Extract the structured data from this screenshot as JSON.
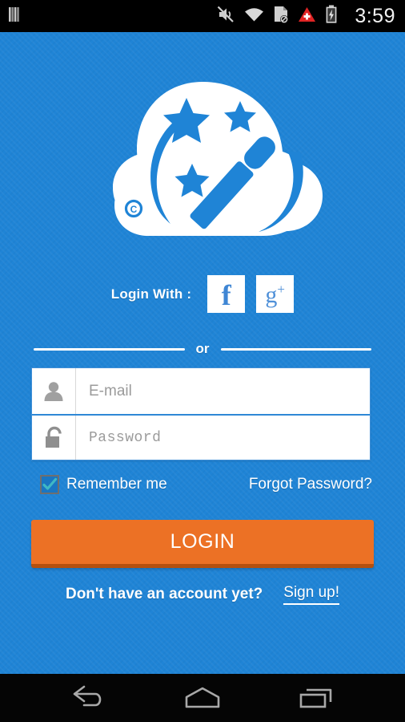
{
  "statusbar": {
    "time": "3:59",
    "icons": [
      "sim-signal-icon",
      "mute-icon",
      "wifi-icon",
      "sd-card-disabled-icon",
      "alert-triangle-icon",
      "battery-charging-icon"
    ]
  },
  "logo": {
    "name": "cloud-magic-wand-logo",
    "copyright_mark": "C",
    "color": "#ffffff"
  },
  "social": {
    "label": "Login With :",
    "buttons": [
      {
        "name": "facebook-login-button",
        "glyph": "f"
      },
      {
        "name": "google-plus-login-button",
        "glyph": "g",
        "sup": "+"
      }
    ]
  },
  "divider": {
    "text": "or"
  },
  "form": {
    "email": {
      "placeholder": "E-mail",
      "value": "",
      "icon": "user-icon"
    },
    "password": {
      "placeholder": "Password",
      "value": "",
      "icon": "unlocked-padlock-icon"
    }
  },
  "options": {
    "remember_label": "Remember me",
    "remember_checked": true,
    "forgot_label": "Forgot Password?"
  },
  "actions": {
    "login_label": "LOGIN"
  },
  "signup": {
    "prompt": "Don't have an account yet?",
    "link_label": "Sign up!"
  },
  "navbar": {
    "back": "back-icon",
    "home": "home-icon",
    "recents": "recent-apps-icon"
  },
  "colors": {
    "background_blue": "#1f84d6",
    "accent_orange": "#ec7125",
    "orange_shadow": "#b4500f",
    "checkmark_teal": "#3fb8c4",
    "white": "#ffffff",
    "statusbar_black": "#000000"
  }
}
